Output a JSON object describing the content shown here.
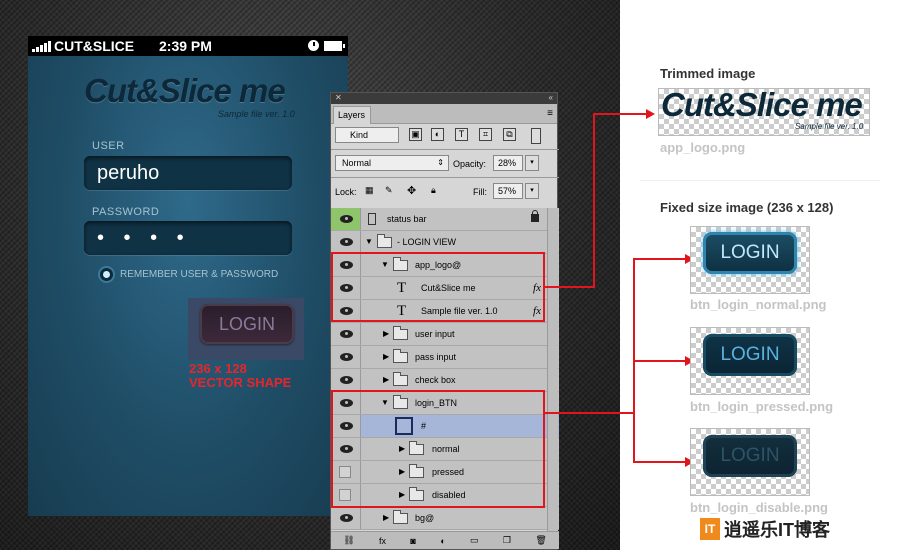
{
  "phone": {
    "carrier": "CUT&SLICE",
    "time": "2:39 PM",
    "logo": "Cut&Slice me",
    "logo_sub": "Sample file ver. 1.0",
    "user_label": "USER",
    "user_value": "peruho",
    "password_label": "PASSWORD",
    "password_value": "• • • •",
    "remember_label": "REMEMBER USER & PASSWORD",
    "login_label": "LOGIN",
    "vector_note_line1": "236 x 128",
    "vector_note_line2": "VECTOR SHAPE"
  },
  "panel": {
    "tab": "Layers",
    "kind": "Kind",
    "blend_mode": "Normal",
    "opacity_label": "Opacity:",
    "opacity_value": "28%",
    "lock_label": "Lock:",
    "fill_label": "Fill:",
    "fill_value": "57%",
    "layers": [
      {
        "name": "status bar"
      },
      {
        "name": "- LOGIN VIEW"
      },
      {
        "name": "app_logo@"
      },
      {
        "name": "Cut&Slice me"
      },
      {
        "name": "Sample file ver. 1.0"
      },
      {
        "name": "user input"
      },
      {
        "name": "pass input"
      },
      {
        "name": "check box"
      },
      {
        "name": "login_BTN"
      },
      {
        "name": "#"
      },
      {
        "name": "normal"
      },
      {
        "name": "pressed"
      },
      {
        "name": "disabled"
      },
      {
        "name": "bg@"
      }
    ],
    "fx": "fx"
  },
  "right": {
    "trimmed_title": "Trimmed image",
    "trim_logo": "Cut&Slice me",
    "trim_sub": "Sample file ver. 1.0",
    "trim_file": "app_logo.png",
    "fixed_title": "Fixed size image (236 x 128)",
    "btn_label": "LOGIN",
    "file_normal": "btn_login_normal.png",
    "file_pressed": "btn_login_pressed.png",
    "file_disable": "btn_login_disable.png"
  },
  "watermark": {
    "icon": "IT",
    "text": "逍遥乐IT博客"
  }
}
